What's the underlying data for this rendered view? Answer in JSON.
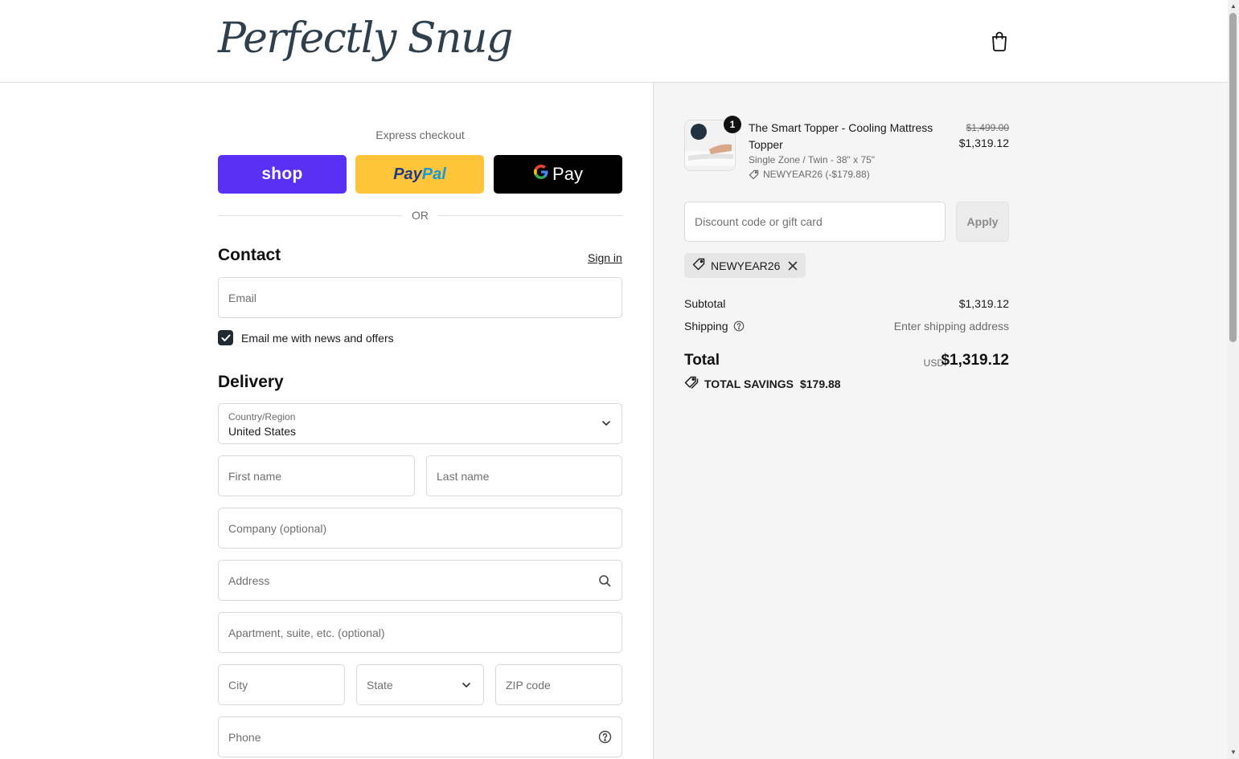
{
  "header": {
    "logo_text": "Perfectly Snug",
    "cart_icon": "shopping-bag-icon"
  },
  "express": {
    "label": "Express checkout",
    "shop_label": "shop",
    "paypal_part1": "Pay",
    "paypal_part2": "Pal",
    "gpay_label": "Pay",
    "or_label": "OR"
  },
  "contact": {
    "title": "Contact",
    "signin_label": "Sign in",
    "email_placeholder": "Email",
    "newsletter_label": "Email me with news and offers",
    "newsletter_checked": true
  },
  "delivery": {
    "title": "Delivery",
    "country_label": "Country/Region",
    "country_value": "United States",
    "first_name_placeholder": "First name",
    "last_name_placeholder": "Last name",
    "company_placeholder": "Company (optional)",
    "address_placeholder": "Address",
    "apartment_placeholder": "Apartment, suite, etc. (optional)",
    "city_placeholder": "City",
    "state_placeholder": "State",
    "zip_placeholder": "ZIP code",
    "phone_placeholder": "Phone"
  },
  "summary": {
    "product": {
      "quantity": "1",
      "name": "The Smart Topper - Cooling Mattress Topper",
      "variant": "Single Zone / Twin - 38\" x 75\"",
      "discount_line": "NEWYEAR26 (-$179.88)",
      "price_original": "$1,499.00",
      "price_current": "$1,319.12"
    },
    "discount_placeholder": "Discount code or gift card",
    "apply_label": "Apply",
    "applied_code": "NEWYEAR26",
    "subtotal_label": "Subtotal",
    "subtotal_value": "$1,319.12",
    "shipping_label": "Shipping",
    "shipping_value": "Enter shipping address",
    "total_label": "Total",
    "currency": "USD",
    "total_value": "$1,319.12",
    "savings_label": "TOTAL SAVINGS",
    "savings_value": "$179.88"
  },
  "colors": {
    "shop_purple": "#5a31f4",
    "paypal_yellow": "#ffc439",
    "gpay_black": "#000000",
    "checkbox_dark": "#1f2a33",
    "summary_bg": "#f5f5f5"
  }
}
